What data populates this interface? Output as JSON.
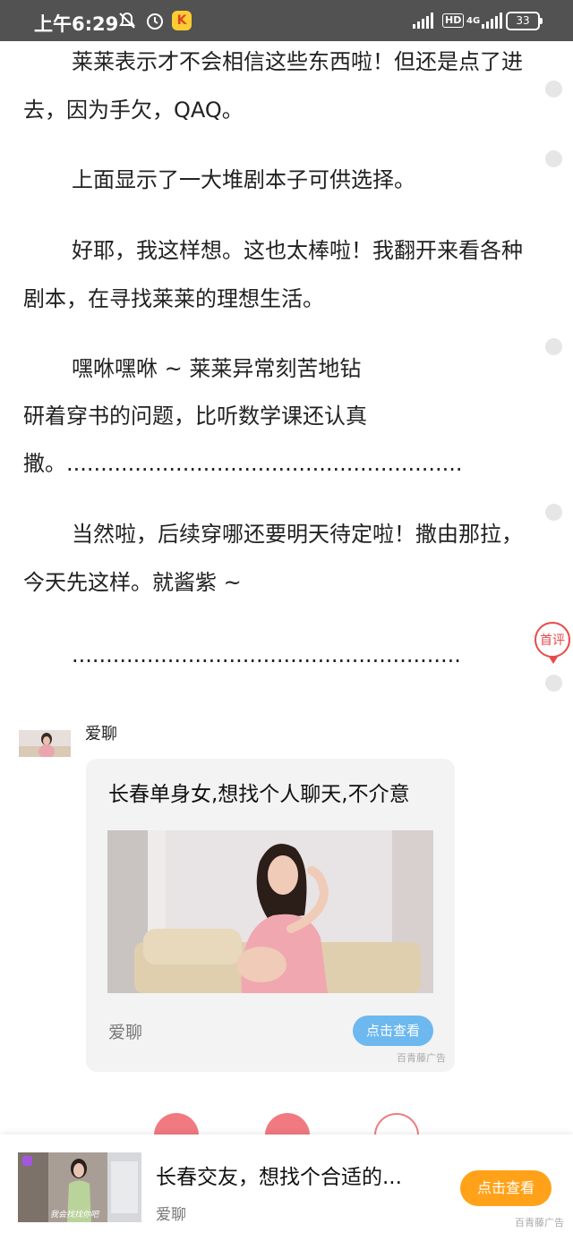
{
  "status_bar": {
    "time": "上午6:29",
    "network": "4G",
    "hd_label": "HD",
    "battery": "33"
  },
  "article": {
    "paragraphs": [
      "莱莱表示才不会相信这些东西啦！但还是点了进去，因为手欠，QAQ。",
      "上面显示了一大堆剧本子可供选择。",
      "好耶，我这样想。这也太棒啦！我翻开来看各种剧本，在寻找莱莱的理想生活。",
      "嘿咻嘿咻 ~ 莱莱异常刻苦地钻",
      "研着穿书的问题，比听数学课还认真",
      "撒。..........................................................",
      "当然啦，后续穿哪还要明天待定啦！撒由那拉，今天先这样。就酱紫 ~",
      "........................................................."
    ],
    "first_comment_label": "首评"
  },
  "ad_feed": {
    "advertiser": "爱聊",
    "title": "长春单身女,想找个人聊天,不介意",
    "source": "爱聊",
    "button": "点击查看",
    "tag": "百青藤广告",
    "accent_color": "#6cb8ef"
  },
  "bottom_banner": {
    "title": "长春交友，想找个合适的...",
    "source": "爱聊",
    "button": "点击查看",
    "tag": "百青藤广告",
    "thumb_caption": "我会找找你吧",
    "accent_color": "#ffa21a"
  }
}
